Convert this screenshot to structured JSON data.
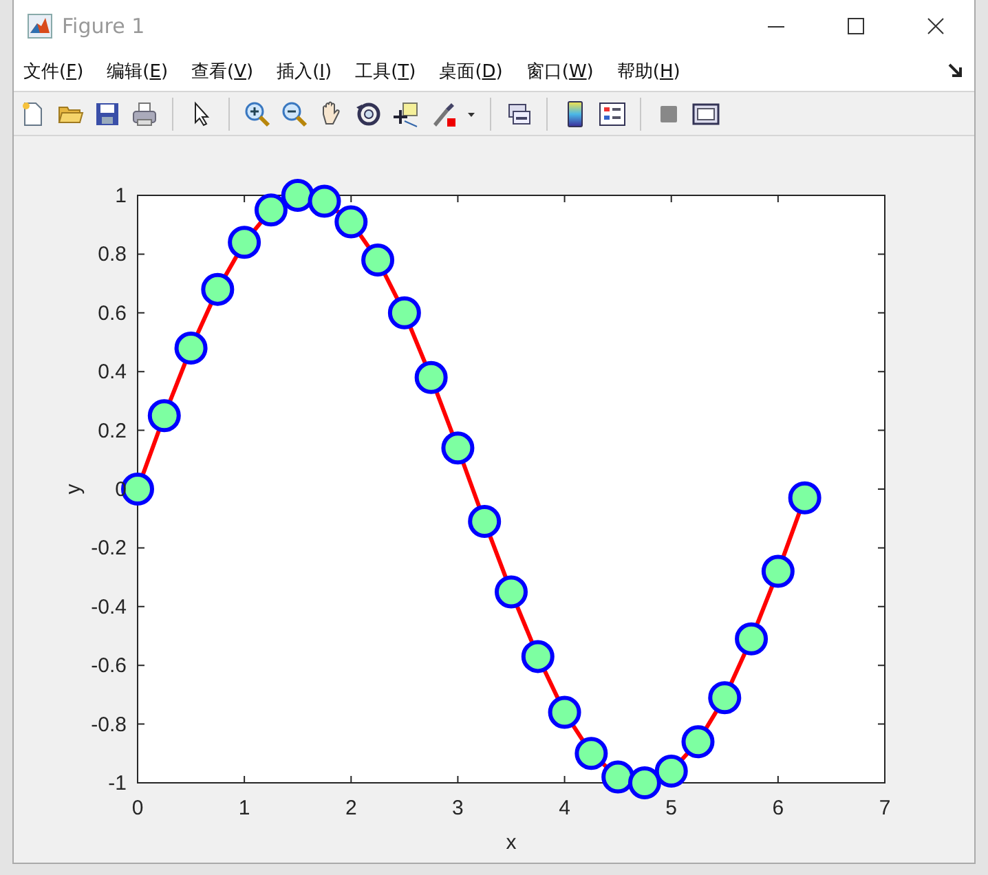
{
  "window": {
    "title": "Figure 1"
  },
  "menu": [
    {
      "text": "文件(",
      "key": "F",
      "end": ")"
    },
    {
      "text": "编辑(",
      "key": "E",
      "end": ")"
    },
    {
      "text": "查看(",
      "key": "V",
      "end": ")"
    },
    {
      "text": "插入(",
      "key": "I",
      "end": ")"
    },
    {
      "text": "工具(",
      "key": "T",
      "end": ")"
    },
    {
      "text": "桌面(",
      "key": "D",
      "end": ")"
    },
    {
      "text": "窗口(",
      "key": "W",
      "end": ")"
    },
    {
      "text": "帮助(",
      "key": "H",
      "end": ")"
    }
  ],
  "chart_data": {
    "type": "line",
    "xlabel": "x",
    "ylabel": "y",
    "x": [
      0,
      0.25,
      0.5,
      0.75,
      1,
      1.25,
      1.5,
      1.75,
      2,
      2.25,
      2.5,
      2.75,
      3,
      3.25,
      3.5,
      3.75,
      4,
      4.25,
      4.5,
      4.75,
      5,
      5.25,
      5.5,
      5.75,
      6,
      6.25
    ],
    "series": [
      {
        "color": "#ff0000",
        "marker": "o",
        "values": [
          0,
          0.25,
          0.48,
          0.68,
          0.84,
          0.95,
          1,
          0.98,
          0.91,
          0.78,
          0.6,
          0.38,
          0.14,
          -0.11,
          -0.35,
          -0.57,
          -0.76,
          -0.9,
          -0.98,
          -1,
          -0.96,
          -0.86,
          -0.71,
          -0.51,
          -0.28,
          -0.03
        ]
      }
    ],
    "xlim": [
      0,
      7
    ],
    "ylim": [
      -1,
      1
    ],
    "xticks": [
      0,
      1,
      2,
      3,
      4,
      5,
      6,
      7
    ],
    "yticks": [
      -1,
      -0.8,
      -0.6,
      -0.4,
      -0.2,
      0,
      0.2,
      0.4,
      0.6,
      0.8,
      1
    ]
  }
}
